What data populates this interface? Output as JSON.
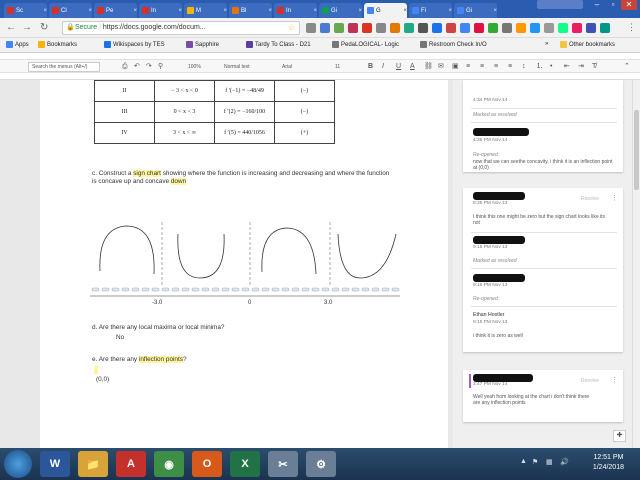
{
  "browser": {
    "tabs": [
      {
        "label": "Sc",
        "color": "#d93025"
      },
      {
        "label": "Cl",
        "color": "#d93025"
      },
      {
        "label": "Pe",
        "color": "#d93025"
      },
      {
        "label": "In",
        "color": "#d93025"
      },
      {
        "label": "M",
        "color": "#f4b400"
      },
      {
        "label": "Bl",
        "color": "#e8710a"
      },
      {
        "label": "In",
        "color": "#d93025"
      },
      {
        "label": "Gi",
        "color": "#0f9d58"
      },
      {
        "label": "G",
        "color": "#4285f4"
      },
      {
        "label": "Fi",
        "color": "#4285f4"
      },
      {
        "label": "Gi",
        "color": "#4285f4"
      }
    ],
    "active_tab_index": 8,
    "user_label": "",
    "secure_label": "Secure",
    "url": "https://docs.google.com/docum..."
  },
  "bookmarks": {
    "apps": "Apps",
    "items": [
      "Bookmarks",
      "Wikispaces by TES",
      "Sapphire",
      "Tardy To Class - D21",
      "PedaLOGICAL- Logic",
      "Restroom Check In/O"
    ],
    "more": "»",
    "other": "Other bookmarks"
  },
  "toolbar": {
    "search_placeholder": "Search the menus (Alt+/)",
    "zoom": "100%",
    "style": "Normal text",
    "font": "Arial",
    "size": "11",
    "bold": "B",
    "italic": "I",
    "underline": "U",
    "color": "A"
  },
  "table": {
    "rows": [
      {
        "interval": "II",
        "range": "− 3 < x < 0",
        "value": "f ′(−1) = −48/49",
        "sign": "(−)"
      },
      {
        "interval": "III",
        "range": "0 < x < 3",
        "value": "f ′(2) = −160/100",
        "sign": "(−)"
      },
      {
        "interval": "IV",
        "range": "3 < x < ∞",
        "value": "f ′(5) = 440/1056",
        "sign": "(+)"
      }
    ]
  },
  "doc": {
    "q_c_pre": "c.  Construct a ",
    "q_c_hl1": "sign chart",
    "q_c_mid": " showing where the function is increasing and decreasing and where the function is concave up and concave ",
    "q_c_hl2": "down",
    "tick_left": "-3.0",
    "tick_mid": "0",
    "tick_right": "3.0",
    "q_d": "d. Are there any local maxima or local minima?",
    "a_d": "No",
    "q_e_pre": "e. Are there any ",
    "q_e_hl": "inflection points",
    "q_e_post": "?",
    "a_e": "(0,0)"
  },
  "comments": {
    "c1_time": "4:34 PM Nov 14",
    "c1_status": "Marked as resolved",
    "c2_time": "4:35 PM Nov 14",
    "c2_status": "Re-opened",
    "c2_text": "now that we can seethe concavity, i think it is an inflection point at (0,0)",
    "c3_time": "8:35 PM Nov 13",
    "c3_resolve": "Resolve",
    "c3_text": "I think this one might be zero but the sign chart looks like its not",
    "c4_time": "9:15 PM Nov 13",
    "c4_status": "Marked as resolved",
    "c5_time": "9:16 PM Nov 13",
    "c5_status": "Re-opened",
    "c6_name": "Ethan Hostler",
    "c6_time": "9:15 PM Nov 13",
    "c6_text": "i think it is zero as well",
    "c7_time": "3:47 PM Nov 14",
    "c7_resolve": "Resolve",
    "c7_text": "Well yeah from looking at the chart i don't think there are any inflection points"
  },
  "taskbar": {
    "apps": [
      {
        "name": "W",
        "color": "#2b579a"
      },
      {
        "name": "📁",
        "color": "#d8a43a"
      },
      {
        "name": "A",
        "color": "#c4302b"
      },
      {
        "name": "◉",
        "color": "#3c8f45"
      },
      {
        "name": "O",
        "color": "#d85a1a"
      },
      {
        "name": "X",
        "color": "#217346"
      },
      {
        "name": "✂",
        "color": "#6a7f96"
      },
      {
        "name": "⚙",
        "color": "#6a7f96"
      }
    ],
    "time": "12:51 PM",
    "date": "1/24/2018"
  }
}
